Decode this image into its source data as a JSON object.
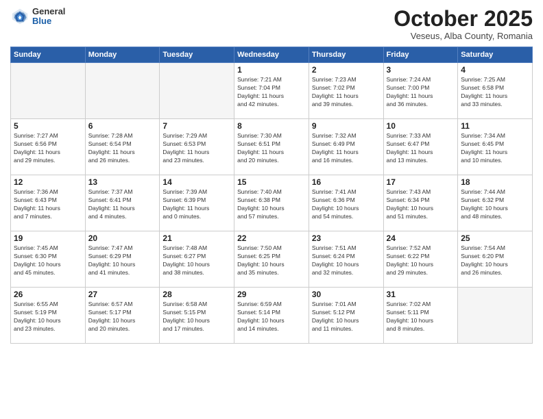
{
  "header": {
    "logo": {
      "general": "General",
      "blue": "Blue"
    },
    "month": "October 2025",
    "location": "Veseus, Alba County, Romania"
  },
  "days_of_week": [
    "Sunday",
    "Monday",
    "Tuesday",
    "Wednesday",
    "Thursday",
    "Friday",
    "Saturday"
  ],
  "weeks": [
    [
      {
        "day": "",
        "info": ""
      },
      {
        "day": "",
        "info": ""
      },
      {
        "day": "",
        "info": ""
      },
      {
        "day": "1",
        "info": "Sunrise: 7:21 AM\nSunset: 7:04 PM\nDaylight: 11 hours\nand 42 minutes."
      },
      {
        "day": "2",
        "info": "Sunrise: 7:23 AM\nSunset: 7:02 PM\nDaylight: 11 hours\nand 39 minutes."
      },
      {
        "day": "3",
        "info": "Sunrise: 7:24 AM\nSunset: 7:00 PM\nDaylight: 11 hours\nand 36 minutes."
      },
      {
        "day": "4",
        "info": "Sunrise: 7:25 AM\nSunset: 6:58 PM\nDaylight: 11 hours\nand 33 minutes."
      }
    ],
    [
      {
        "day": "5",
        "info": "Sunrise: 7:27 AM\nSunset: 6:56 PM\nDaylight: 11 hours\nand 29 minutes."
      },
      {
        "day": "6",
        "info": "Sunrise: 7:28 AM\nSunset: 6:54 PM\nDaylight: 11 hours\nand 26 minutes."
      },
      {
        "day": "7",
        "info": "Sunrise: 7:29 AM\nSunset: 6:53 PM\nDaylight: 11 hours\nand 23 minutes."
      },
      {
        "day": "8",
        "info": "Sunrise: 7:30 AM\nSunset: 6:51 PM\nDaylight: 11 hours\nand 20 minutes."
      },
      {
        "day": "9",
        "info": "Sunrise: 7:32 AM\nSunset: 6:49 PM\nDaylight: 11 hours\nand 16 minutes."
      },
      {
        "day": "10",
        "info": "Sunrise: 7:33 AM\nSunset: 6:47 PM\nDaylight: 11 hours\nand 13 minutes."
      },
      {
        "day": "11",
        "info": "Sunrise: 7:34 AM\nSunset: 6:45 PM\nDaylight: 11 hours\nand 10 minutes."
      }
    ],
    [
      {
        "day": "12",
        "info": "Sunrise: 7:36 AM\nSunset: 6:43 PM\nDaylight: 11 hours\nand 7 minutes."
      },
      {
        "day": "13",
        "info": "Sunrise: 7:37 AM\nSunset: 6:41 PM\nDaylight: 11 hours\nand 4 minutes."
      },
      {
        "day": "14",
        "info": "Sunrise: 7:39 AM\nSunset: 6:39 PM\nDaylight: 11 hours\nand 0 minutes."
      },
      {
        "day": "15",
        "info": "Sunrise: 7:40 AM\nSunset: 6:38 PM\nDaylight: 10 hours\nand 57 minutes."
      },
      {
        "day": "16",
        "info": "Sunrise: 7:41 AM\nSunset: 6:36 PM\nDaylight: 10 hours\nand 54 minutes."
      },
      {
        "day": "17",
        "info": "Sunrise: 7:43 AM\nSunset: 6:34 PM\nDaylight: 10 hours\nand 51 minutes."
      },
      {
        "day": "18",
        "info": "Sunrise: 7:44 AM\nSunset: 6:32 PM\nDaylight: 10 hours\nand 48 minutes."
      }
    ],
    [
      {
        "day": "19",
        "info": "Sunrise: 7:45 AM\nSunset: 6:30 PM\nDaylight: 10 hours\nand 45 minutes."
      },
      {
        "day": "20",
        "info": "Sunrise: 7:47 AM\nSunset: 6:29 PM\nDaylight: 10 hours\nand 41 minutes."
      },
      {
        "day": "21",
        "info": "Sunrise: 7:48 AM\nSunset: 6:27 PM\nDaylight: 10 hours\nand 38 minutes."
      },
      {
        "day": "22",
        "info": "Sunrise: 7:50 AM\nSunset: 6:25 PM\nDaylight: 10 hours\nand 35 minutes."
      },
      {
        "day": "23",
        "info": "Sunrise: 7:51 AM\nSunset: 6:24 PM\nDaylight: 10 hours\nand 32 minutes."
      },
      {
        "day": "24",
        "info": "Sunrise: 7:52 AM\nSunset: 6:22 PM\nDaylight: 10 hours\nand 29 minutes."
      },
      {
        "day": "25",
        "info": "Sunrise: 7:54 AM\nSunset: 6:20 PM\nDaylight: 10 hours\nand 26 minutes."
      }
    ],
    [
      {
        "day": "26",
        "info": "Sunrise: 6:55 AM\nSunset: 5:19 PM\nDaylight: 10 hours\nand 23 minutes."
      },
      {
        "day": "27",
        "info": "Sunrise: 6:57 AM\nSunset: 5:17 PM\nDaylight: 10 hours\nand 20 minutes."
      },
      {
        "day": "28",
        "info": "Sunrise: 6:58 AM\nSunset: 5:15 PM\nDaylight: 10 hours\nand 17 minutes."
      },
      {
        "day": "29",
        "info": "Sunrise: 6:59 AM\nSunset: 5:14 PM\nDaylight: 10 hours\nand 14 minutes."
      },
      {
        "day": "30",
        "info": "Sunrise: 7:01 AM\nSunset: 5:12 PM\nDaylight: 10 hours\nand 11 minutes."
      },
      {
        "day": "31",
        "info": "Sunrise: 7:02 AM\nSunset: 5:11 PM\nDaylight: 10 hours\nand 8 minutes."
      },
      {
        "day": "",
        "info": ""
      }
    ]
  ]
}
